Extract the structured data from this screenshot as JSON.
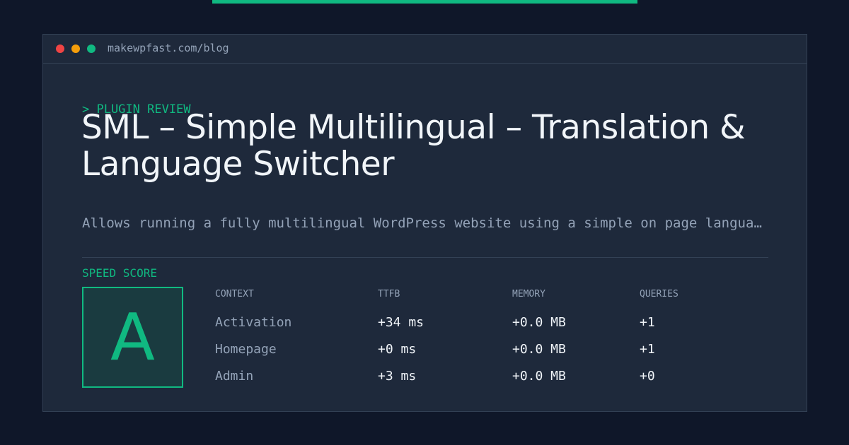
{
  "colors": {
    "background": "#0f1729",
    "card": "#1e293b",
    "accent": "#10b981",
    "text": "#f1f5f9",
    "muted": "#94a3b8"
  },
  "browser": {
    "url": "makewpfast.com/blog"
  },
  "post": {
    "kicker": "> PLUGIN REVIEW",
    "title": "SML – Simple Multilingual – Translation & Language Switcher",
    "description": "Allows running a fully multilingual WordPress website using a simple on page language switcher and translation management."
  },
  "speed": {
    "label": "SPEED SCORE",
    "grade": "A"
  },
  "table": {
    "headers": [
      "CONTEXT",
      "TTFB",
      "MEMORY",
      "QUERIES"
    ],
    "rows": [
      [
        "Activation",
        "+34 ms",
        "+0.0 MB",
        "+1"
      ],
      [
        "Homepage",
        "+0 ms",
        "+0.0 MB",
        "+1"
      ],
      [
        "Admin",
        "+3 ms",
        "+0.0 MB",
        "+0"
      ]
    ]
  }
}
